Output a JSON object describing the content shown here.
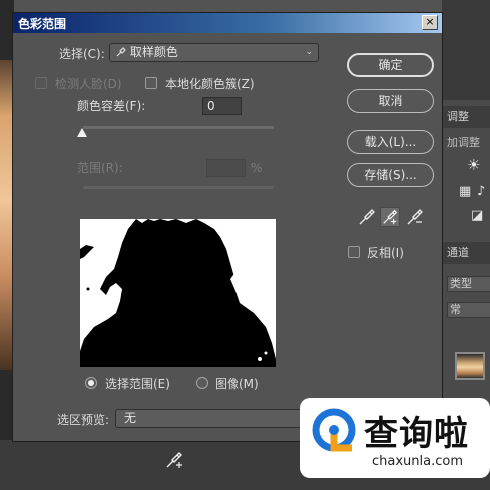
{
  "dialog": {
    "title": "色彩范围",
    "close_label": "×",
    "select_label": "选择(C):",
    "select_value": "取样颜色",
    "detect_faces_label": "检测人脸(D)",
    "localized_clusters_label": "本地化颜色簇(Z)",
    "fuzziness_label": "颜色容差(F):",
    "fuzziness_value": "0",
    "fuzziness_level": 0,
    "range_label": "范围(R):",
    "range_value": "",
    "range_unit": "%",
    "view_selection_label": "选择范围(E)",
    "view_image_label": "图像(M)",
    "view_mode": "selection",
    "selection_preview_label": "选区预览:",
    "selection_preview_value": "无",
    "invert_label": "反相(I)",
    "invert_checked": false
  },
  "buttons": {
    "ok": "确定",
    "cancel": "取消",
    "load": "载入(L)...",
    "save": "存储(S)..."
  },
  "eyedroppers": [
    "eyedropper-icon",
    "eyedropper-plus-icon",
    "eyedropper-minus-icon"
  ],
  "right_panel": {
    "tab_adjust": "调整",
    "add_adjust": "加调整",
    "layers_tab": "通道",
    "kind_label": "类型",
    "mode_label": "常"
  },
  "watermark": {
    "brand": "查询啦",
    "url": "chaxunla.com"
  },
  "colors": {
    "dialog_bg": "#535353",
    "title_gradient_start": "#0a246a",
    "title_gradient_end": "#a6caf0",
    "watermark_blue": "#1e74d6",
    "watermark_orange": "#f2a01c"
  }
}
